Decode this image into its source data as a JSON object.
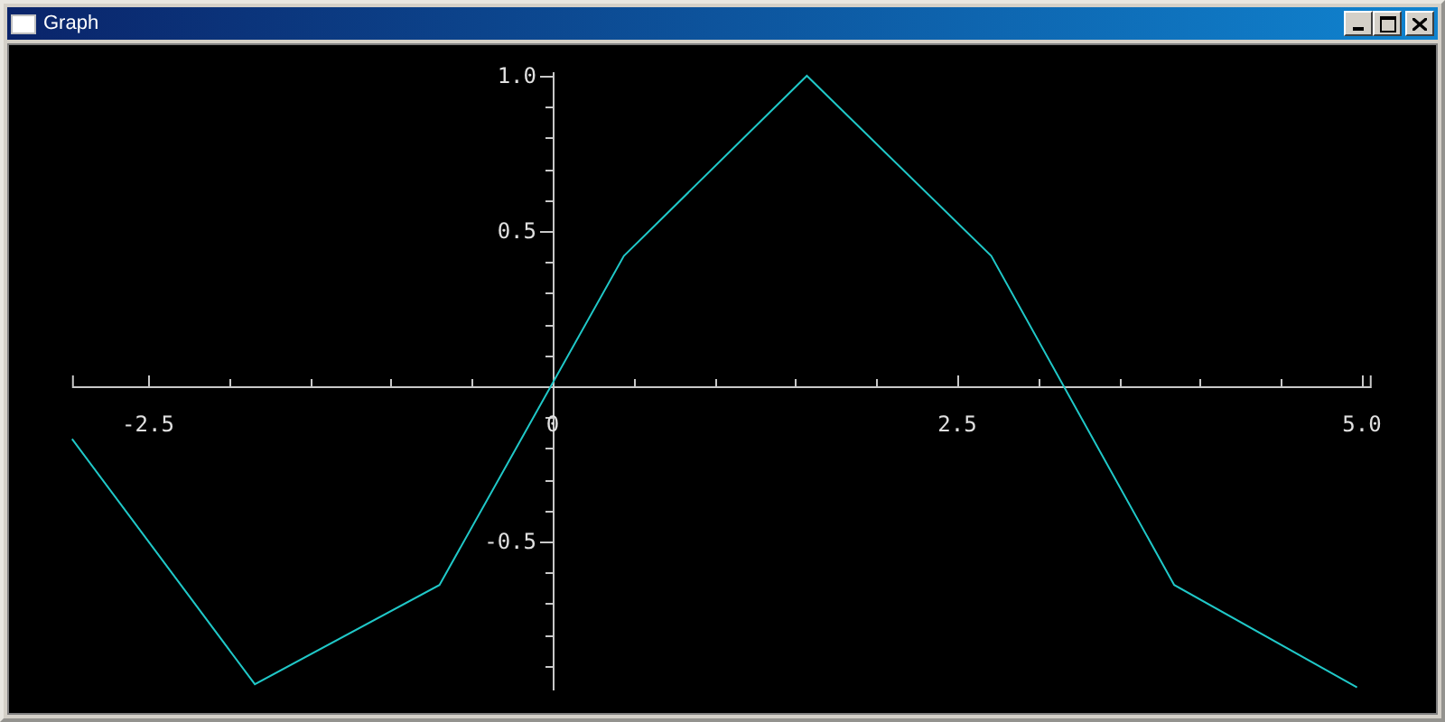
{
  "window": {
    "title": "Graph"
  },
  "chart_data": {
    "type": "line",
    "x": [
      -2.97,
      -1.84,
      -0.7,
      0.44,
      1.57,
      2.71,
      3.84,
      4.97
    ],
    "series": [
      {
        "color": "#20c8c8",
        "values": [
          -0.17,
          -0.96,
          -0.64,
          0.42,
          1.0,
          0.42,
          -0.64,
          -0.97
        ]
      }
    ],
    "xlim": [
      -2.97,
      5.06
    ],
    "ylim": [
      -0.98,
      1.0
    ],
    "xticks": [
      {
        "value": -2.5,
        "label": "-2.5"
      },
      {
        "value": 0,
        "label": "0"
      },
      {
        "value": 2.5,
        "label": "2.5"
      },
      {
        "value": 5.0,
        "label": "5.0"
      }
    ],
    "yticks": [
      {
        "value": 1.0,
        "label": "1.0"
      },
      {
        "value": 0.5,
        "label": "0.5"
      },
      {
        "value": -0.5,
        "label": "-0.5"
      }
    ]
  }
}
